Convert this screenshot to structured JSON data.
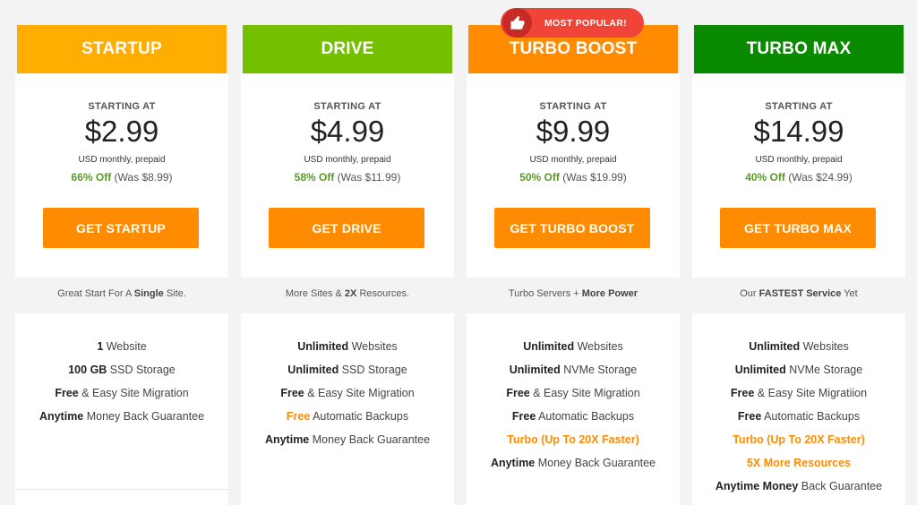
{
  "badge": {
    "text": "MOST POPULAR!",
    "icon": "thumbs-up-icon"
  },
  "colors": {
    "cta": "#ff8c00",
    "discount": "#5a9a2a",
    "highlight": "#ff8c00",
    "badge": "#f04438"
  },
  "plans": [
    {
      "name": "STARTUP",
      "header_color": "#ffad00",
      "starting_label": "STARTING AT",
      "price": "$2.99",
      "period": "USD monthly, prepaid",
      "discount": "66% Off",
      "was": " (Was $8.99)",
      "cta": "GET STARTUP",
      "tagline": {
        "pre": "Great Start For A ",
        "bold": "Single",
        "post": " Site."
      },
      "features": [
        {
          "bold": "1",
          "text": " Website"
        },
        {
          "bold": "100 GB",
          "text": " SSD Storage"
        },
        {
          "bold": "Free",
          "text": " & Easy Site Migration"
        },
        {
          "bold": "Anytime",
          "text": " Money Back Guarantee"
        }
      ]
    },
    {
      "name": "DRIVE",
      "header_color": "#74bf00",
      "starting_label": "STARTING AT",
      "price": "$4.99",
      "period": "USD monthly, prepaid",
      "discount": "58% Off",
      "was": " (Was $11.99)",
      "cta": "GET DRIVE",
      "tagline": {
        "pre": "More Sites & ",
        "bold": "2X",
        "post": " Resources."
      },
      "features": [
        {
          "bold": "Unlimited",
          "text": " Websites"
        },
        {
          "bold": "Unlimited",
          "text": " SSD Storage"
        },
        {
          "bold": "Free",
          "text": " & Easy Site Migration"
        },
        {
          "highlight": "Free",
          "text": " Automatic Backups"
        },
        {
          "bold": "Anytime",
          "text": " Money Back Guarantee"
        }
      ]
    },
    {
      "name": "TURBO BOOST",
      "header_color": "#ff8c00",
      "starting_label": "STARTING AT",
      "price": "$9.99",
      "period": "USD monthly, prepaid",
      "discount": "50% Off",
      "was": " (Was $19.99)",
      "cta": "GET TURBO BOOST",
      "tagline": {
        "pre": "Turbo Servers + ",
        "bold": "More Power",
        "post": ""
      },
      "features": [
        {
          "bold": "Unlimited",
          "text": " Websites"
        },
        {
          "bold": "Unlimited",
          "text": " NVMe Storage"
        },
        {
          "bold": "Free",
          "text": " & Easy Site Migration"
        },
        {
          "bold": "Free",
          "text": " Automatic Backups"
        },
        {
          "highlight": "Turbo (Up To 20X Faster)",
          "text": ""
        },
        {
          "bold": "Anytime",
          "text": " Money Back Guarantee"
        }
      ]
    },
    {
      "name": "TURBO MAX",
      "header_color": "#0a8a00",
      "starting_label": "STARTING AT",
      "price": "$14.99",
      "period": "USD monthly, prepaid",
      "discount": "40% Off",
      "was": " (Was $24.99)",
      "cta": "GET TURBO MAX",
      "tagline": {
        "pre": "Our ",
        "bold": "FASTEST Service",
        "post": " Yet"
      },
      "features": [
        {
          "bold": "Unlimited",
          "text": " Websites"
        },
        {
          "bold": "Unlimited",
          "text": " NVMe Storage"
        },
        {
          "bold": "Free",
          "text": " & Easy Site Migratiion"
        },
        {
          "bold": "Free",
          "text": " Automatic Backups"
        },
        {
          "highlight": "Turbo (Up To 20X Faster)",
          "text": ""
        },
        {
          "highlight": "5X More Resources",
          "text": ""
        },
        {
          "bold": "Anytime Money",
          "text": " Back Guarantee"
        }
      ]
    }
  ]
}
